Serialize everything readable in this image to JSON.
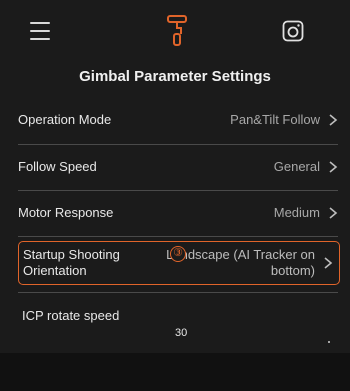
{
  "header": {
    "menu_icon": "hamburger-menu-icon",
    "gimbal_icon": "gimbal-icon",
    "camera_icon": "camera-icon",
    "accent_color": "#e0642a"
  },
  "page": {
    "title": "Gimbal Parameter Settings"
  },
  "settings": [
    {
      "label": "Operation Mode",
      "value": "Pan&Tilt Follow"
    },
    {
      "label": "Follow Speed",
      "value": "General"
    },
    {
      "label": "Motor Response",
      "value": "Medium"
    },
    {
      "label": "Startup Shooting Orientation",
      "value": "Landscape (AI Tracker on bottom)"
    }
  ],
  "callout": {
    "number": "③"
  },
  "icp": {
    "label": "ICP rotate speed",
    "value": "30"
  }
}
